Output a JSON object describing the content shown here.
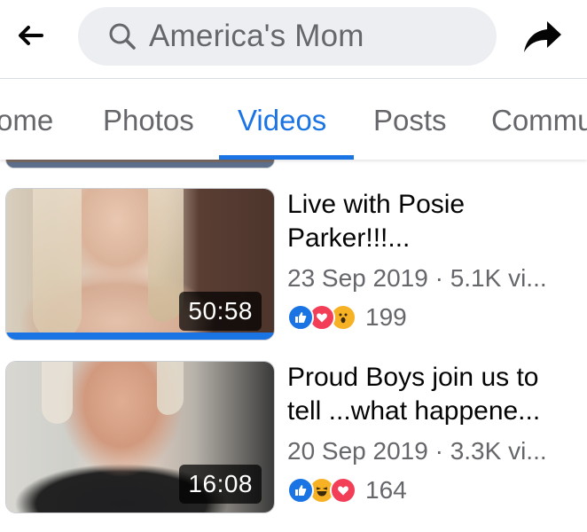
{
  "header": {
    "search_value": "America's Mom",
    "back_icon": "back-arrow-icon",
    "search_icon": "search-icon",
    "share_icon": "share-arrow-icon"
  },
  "tabs": [
    {
      "label": "ome",
      "active": false
    },
    {
      "label": "Photos",
      "active": false
    },
    {
      "label": "Videos",
      "active": true
    },
    {
      "label": "Posts",
      "active": false
    },
    {
      "label": "Commu",
      "active": false
    }
  ],
  "videos": [
    {
      "title": "Live with Posie\nParker!!!...",
      "meta": "23 Sep 2019 · 5.1K vi...",
      "duration": "50:58",
      "watched": 1.0,
      "reactions": [
        "like",
        "love",
        "wow"
      ],
      "reaction_count": "199"
    },
    {
      "title": "Proud Boys join us to\ntell ...what happene...",
      "meta": "20 Sep 2019 · 3.3K vi...",
      "duration": "16:08",
      "watched": 0,
      "reactions": [
        "like",
        "haha",
        "love"
      ],
      "reaction_count": "164"
    }
  ],
  "colors": {
    "accent": "#1b74e4",
    "secondary_text": "#65676b",
    "love": "#f33e58",
    "wow": "#f7b125"
  }
}
